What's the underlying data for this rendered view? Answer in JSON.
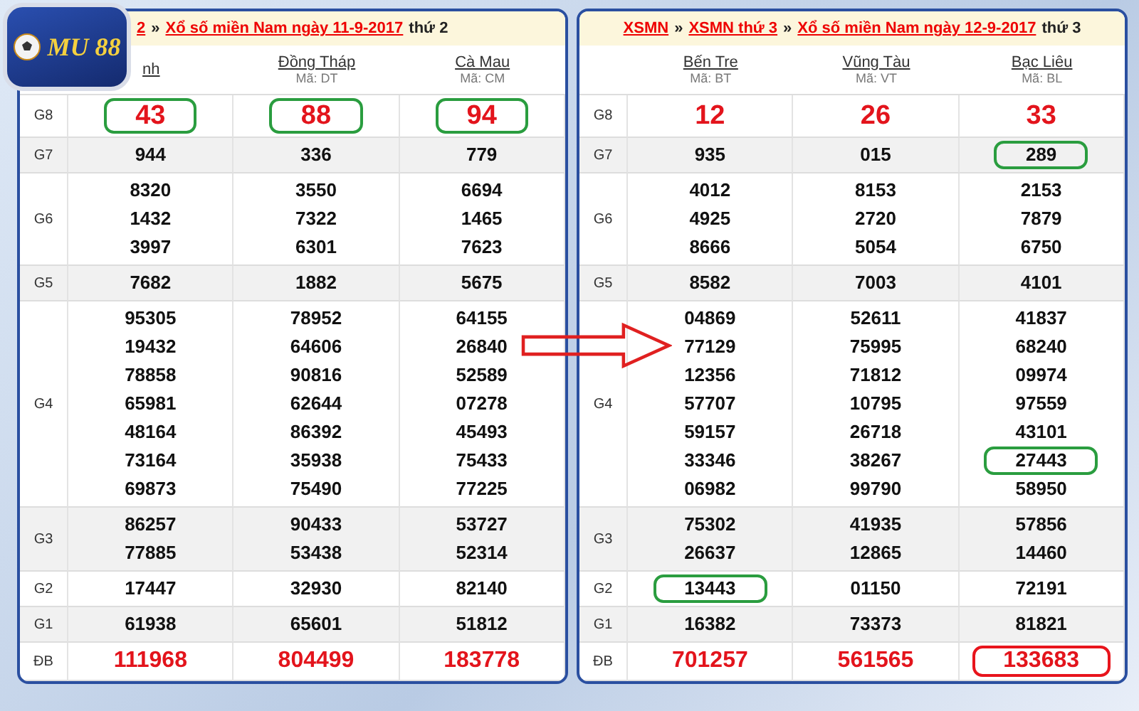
{
  "logo": "MU 88",
  "panels": [
    {
      "breadcrumb": [
        {
          "text": "2",
          "kind": "link"
        },
        {
          "text": "»",
          "kind": "sep"
        },
        {
          "text": "Xổ số miền Nam ngày 11-9-2017",
          "kind": "link"
        },
        {
          "text": "thứ 2",
          "kind": "plain"
        }
      ],
      "provinces": [
        {
          "name": "nh"
        },
        {
          "name": "Đồng Tháp",
          "code": "Mã: DT"
        },
        {
          "name": "Cà Mau",
          "code": "Mã: CM"
        }
      ],
      "rows": [
        {
          "label": "G8",
          "kind": "big",
          "cells": [
            [
              {
                "text": "43",
                "color": "#2a9d3f"
              }
            ],
            [
              {
                "text": "88",
                "color": "#2a9d3f"
              }
            ],
            [
              {
                "text": "94",
                "color": "#2a9d3f"
              }
            ]
          ]
        },
        {
          "label": "G7",
          "kind": "normal",
          "cells": [
            [
              {
                "text": "944"
              }
            ],
            [
              {
                "text": "336"
              }
            ],
            [
              {
                "text": "779"
              }
            ]
          ]
        },
        {
          "label": "G6",
          "kind": "normal",
          "cells": [
            [
              {
                "text": "8320"
              },
              {
                "text": "1432"
              },
              {
                "text": "3997"
              }
            ],
            [
              {
                "text": "3550"
              },
              {
                "text": "7322"
              },
              {
                "text": "6301"
              }
            ],
            [
              {
                "text": "6694"
              },
              {
                "text": "1465"
              },
              {
                "text": "7623"
              }
            ]
          ]
        },
        {
          "label": "G5",
          "kind": "normal",
          "cells": [
            [
              {
                "text": "7682"
              }
            ],
            [
              {
                "text": "1882"
              }
            ],
            [
              {
                "text": "5675"
              }
            ]
          ]
        },
        {
          "label": "G4",
          "kind": "normal",
          "cells": [
            [
              {
                "text": "95305"
              },
              {
                "text": "19432"
              },
              {
                "text": "78858"
              },
              {
                "text": "65981"
              },
              {
                "text": "48164"
              },
              {
                "text": "73164"
              },
              {
                "text": "69873"
              }
            ],
            [
              {
                "text": "78952"
              },
              {
                "text": "64606"
              },
              {
                "text": "90816"
              },
              {
                "text": "62644"
              },
              {
                "text": "86392"
              },
              {
                "text": "35938"
              },
              {
                "text": "75490"
              }
            ],
            [
              {
                "text": "64155"
              },
              {
                "text": "26840"
              },
              {
                "text": "52589"
              },
              {
                "text": "07278"
              },
              {
                "text": "45493"
              },
              {
                "text": "75433"
              },
              {
                "text": "77225"
              }
            ]
          ]
        },
        {
          "label": "G3",
          "kind": "normal",
          "cells": [
            [
              {
                "text": "86257"
              },
              {
                "text": "77885"
              }
            ],
            [
              {
                "text": "90433"
              },
              {
                "text": "53438"
              }
            ],
            [
              {
                "text": "53727"
              },
              {
                "text": "52314"
              }
            ]
          ]
        },
        {
          "label": "G2",
          "kind": "normal",
          "cells": [
            [
              {
                "text": "17447"
              }
            ],
            [
              {
                "text": "32930"
              }
            ],
            [
              {
                "text": "82140"
              }
            ]
          ]
        },
        {
          "label": "G1",
          "kind": "normal",
          "cells": [
            [
              {
                "text": "61938"
              }
            ],
            [
              {
                "text": "65601"
              }
            ],
            [
              {
                "text": "51812"
              }
            ]
          ]
        },
        {
          "label": "ĐB",
          "kind": "special",
          "cells": [
            [
              {
                "text": "111968"
              }
            ],
            [
              {
                "text": "804499"
              }
            ],
            [
              {
                "text": "183778"
              }
            ]
          ]
        }
      ]
    },
    {
      "breadcrumb": [
        {
          "text": "XSMN",
          "kind": "link"
        },
        {
          "text": "»",
          "kind": "sep"
        },
        {
          "text": "XSMN thứ 3",
          "kind": "link"
        },
        {
          "text": "»",
          "kind": "sep"
        },
        {
          "text": "Xổ số miền Nam ngày 12-9-2017",
          "kind": "link"
        },
        {
          "text": "thứ 3",
          "kind": "plain"
        }
      ],
      "provinces": [
        {
          "name": "Bến Tre",
          "code": "Mã: BT"
        },
        {
          "name": "Vũng Tàu",
          "code": "Mã: VT"
        },
        {
          "name": "Bạc Liêu",
          "code": "Mã: BL"
        }
      ],
      "rows": [
        {
          "label": "G8",
          "kind": "big",
          "cells": [
            [
              {
                "text": "12"
              }
            ],
            [
              {
                "text": "26"
              }
            ],
            [
              {
                "text": "33"
              }
            ]
          ]
        },
        {
          "label": "G7",
          "kind": "normal",
          "cells": [
            [
              {
                "text": "935"
              }
            ],
            [
              {
                "text": "015"
              }
            ],
            [
              {
                "text": "289",
                "color": "#2a9d3f"
              }
            ]
          ]
        },
        {
          "label": "G6",
          "kind": "normal",
          "cells": [
            [
              {
                "text": "4012"
              },
              {
                "text": "4925"
              },
              {
                "text": "8666"
              }
            ],
            [
              {
                "text": "8153"
              },
              {
                "text": "2720"
              },
              {
                "text": "5054"
              }
            ],
            [
              {
                "text": "2153"
              },
              {
                "text": "7879"
              },
              {
                "text": "6750"
              }
            ]
          ]
        },
        {
          "label": "G5",
          "kind": "normal",
          "cells": [
            [
              {
                "text": "8582"
              }
            ],
            [
              {
                "text": "7003"
              }
            ],
            [
              {
                "text": "4101"
              }
            ]
          ]
        },
        {
          "label": "G4",
          "kind": "normal",
          "cells": [
            [
              {
                "text": "04869"
              },
              {
                "text": "77129"
              },
              {
                "text": "12356"
              },
              {
                "text": "57707"
              },
              {
                "text": "59157"
              },
              {
                "text": "33346"
              },
              {
                "text": "06982"
              }
            ],
            [
              {
                "text": "52611"
              },
              {
                "text": "75995"
              },
              {
                "text": "71812"
              },
              {
                "text": "10795"
              },
              {
                "text": "26718"
              },
              {
                "text": "38267"
              },
              {
                "text": "99790"
              }
            ],
            [
              {
                "text": "41837"
              },
              {
                "text": "68240"
              },
              {
                "text": "09974"
              },
              {
                "text": "97559"
              },
              {
                "text": "43101"
              },
              {
                "text": "27443",
                "color": "#2a9d3f"
              },
              {
                "text": "58950"
              }
            ]
          ]
        },
        {
          "label": "G3",
          "kind": "normal",
          "cells": [
            [
              {
                "text": "75302"
              },
              {
                "text": "26637"
              }
            ],
            [
              {
                "text": "41935"
              },
              {
                "text": "12865"
              }
            ],
            [
              {
                "text": "57856"
              },
              {
                "text": "14460"
              }
            ]
          ]
        },
        {
          "label": "G2",
          "kind": "normal",
          "cells": [
            [
              {
                "text": "13443",
                "color": "#2a9d3f"
              }
            ],
            [
              {
                "text": "01150"
              }
            ],
            [
              {
                "text": "72191"
              }
            ]
          ]
        },
        {
          "label": "G1",
          "kind": "normal",
          "cells": [
            [
              {
                "text": "16382"
              }
            ],
            [
              {
                "text": "73373"
              }
            ],
            [
              {
                "text": "81821"
              }
            ]
          ]
        },
        {
          "label": "ĐB",
          "kind": "special",
          "cells": [
            [
              {
                "text": "701257"
              }
            ],
            [
              {
                "text": "561565"
              }
            ],
            [
              {
                "text": "133683",
                "color": "#e8141c"
              }
            ]
          ]
        }
      ]
    }
  ]
}
